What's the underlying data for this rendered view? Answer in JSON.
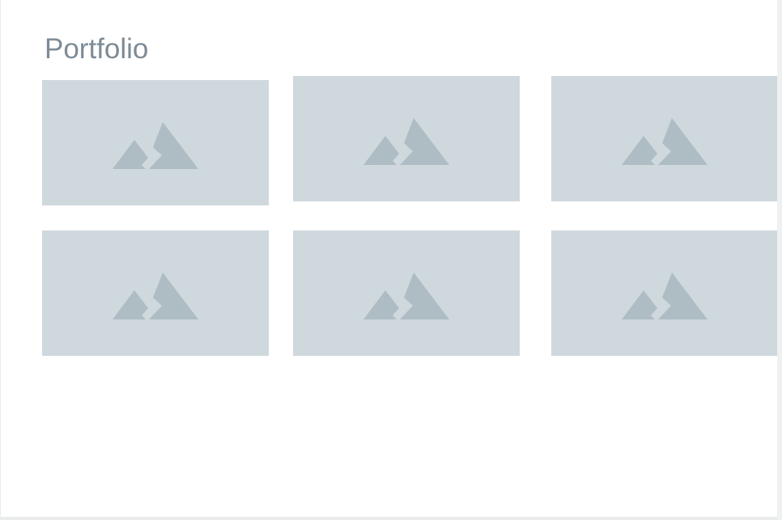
{
  "page": {
    "title": "Portfolio"
  },
  "portfolio": {
    "items": [
      {
        "icon": "image-placeholder-icon"
      },
      {
        "icon": "image-placeholder-icon"
      },
      {
        "icon": "image-placeholder-icon"
      },
      {
        "icon": "image-placeholder-icon"
      },
      {
        "icon": "image-placeholder-icon"
      },
      {
        "icon": "image-placeholder-icon"
      }
    ]
  },
  "colors": {
    "heading": "#7d8b96",
    "tile_background": "#cfd8dd",
    "icon_fill": "#aebcc3",
    "page_background": "#ffffff"
  }
}
